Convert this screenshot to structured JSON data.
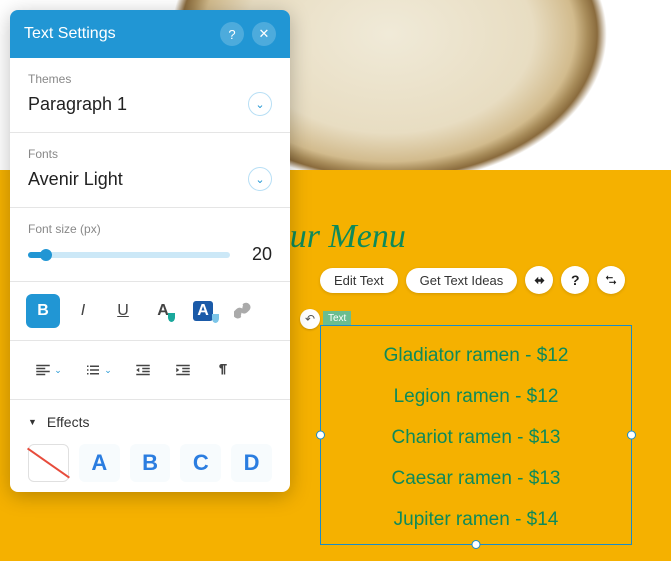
{
  "panel": {
    "title": "Text Settings",
    "themes": {
      "label": "Themes",
      "value": "Paragraph 1"
    },
    "fonts": {
      "label": "Fonts",
      "value": "Avenir Light"
    },
    "fontsize": {
      "label": "Font size (px)",
      "value": "20"
    },
    "effects": {
      "label": "Effects"
    },
    "swatches": [
      "A",
      "B",
      "C",
      "D"
    ]
  },
  "canvas": {
    "title": "Our Menu",
    "toolbar": {
      "editText": "Edit Text",
      "getIdeas": "Get Text Ideas"
    },
    "textTag": "Text",
    "menuItems": [
      "Gladiator ramen - $12",
      "Legion ramen - $12",
      "Chariot ramen - $13",
      "Caesar ramen - $13",
      "Jupiter ramen - $14"
    ]
  }
}
